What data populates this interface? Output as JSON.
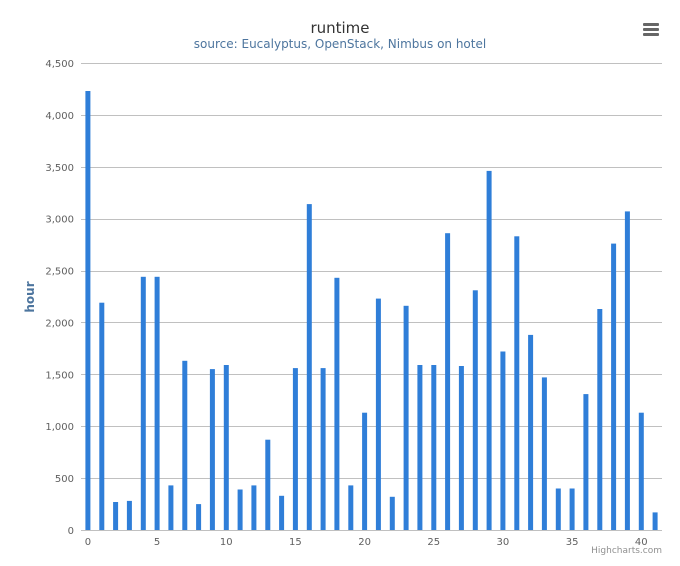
{
  "chart_data": {
    "type": "bar",
    "title": "runtime",
    "subtitle": "source: Eucalyptus, OpenStack, Nimbus on hotel",
    "xlabel": "",
    "ylabel": "hour",
    "x": [
      0,
      1,
      2,
      3,
      4,
      5,
      6,
      7,
      8,
      9,
      10,
      11,
      12,
      13,
      14,
      15,
      16,
      17,
      18,
      19,
      20,
      21,
      22,
      23,
      24,
      25,
      26,
      27,
      28,
      29,
      30,
      31,
      32,
      33,
      34,
      35,
      36,
      37,
      38,
      39,
      40,
      41
    ],
    "values": [
      4230,
      2190,
      270,
      280,
      2440,
      2440,
      430,
      1630,
      250,
      1550,
      1590,
      390,
      430,
      870,
      330,
      1560,
      3140,
      1560,
      2430,
      430,
      1130,
      2230,
      320,
      2160,
      1590,
      1590,
      2860,
      1580,
      2310,
      3460,
      1720,
      2830,
      1880,
      1470,
      400,
      400,
      1310,
      2130,
      2760,
      3070,
      1130,
      170
    ],
    "ylim": [
      0,
      4500
    ],
    "yticks": [
      "0",
      "500",
      "1,000",
      "1,500",
      "2,000",
      "2,500",
      "3,000",
      "3,500",
      "4,000",
      "4,500"
    ],
    "ytick_values": [
      0,
      500,
      1000,
      1500,
      2000,
      2500,
      3000,
      3500,
      4000,
      4500
    ],
    "xticks": [
      "0",
      "5",
      "10",
      "15",
      "20",
      "25",
      "30",
      "35",
      "40"
    ],
    "xtick_values": [
      0,
      5,
      10,
      15,
      20,
      25,
      30,
      35,
      40
    ],
    "grid": true,
    "legend": "none",
    "color": "#2f7ed8"
  },
  "credit": "Highcharts.com",
  "menu_icon": "hamburger-menu-icon"
}
